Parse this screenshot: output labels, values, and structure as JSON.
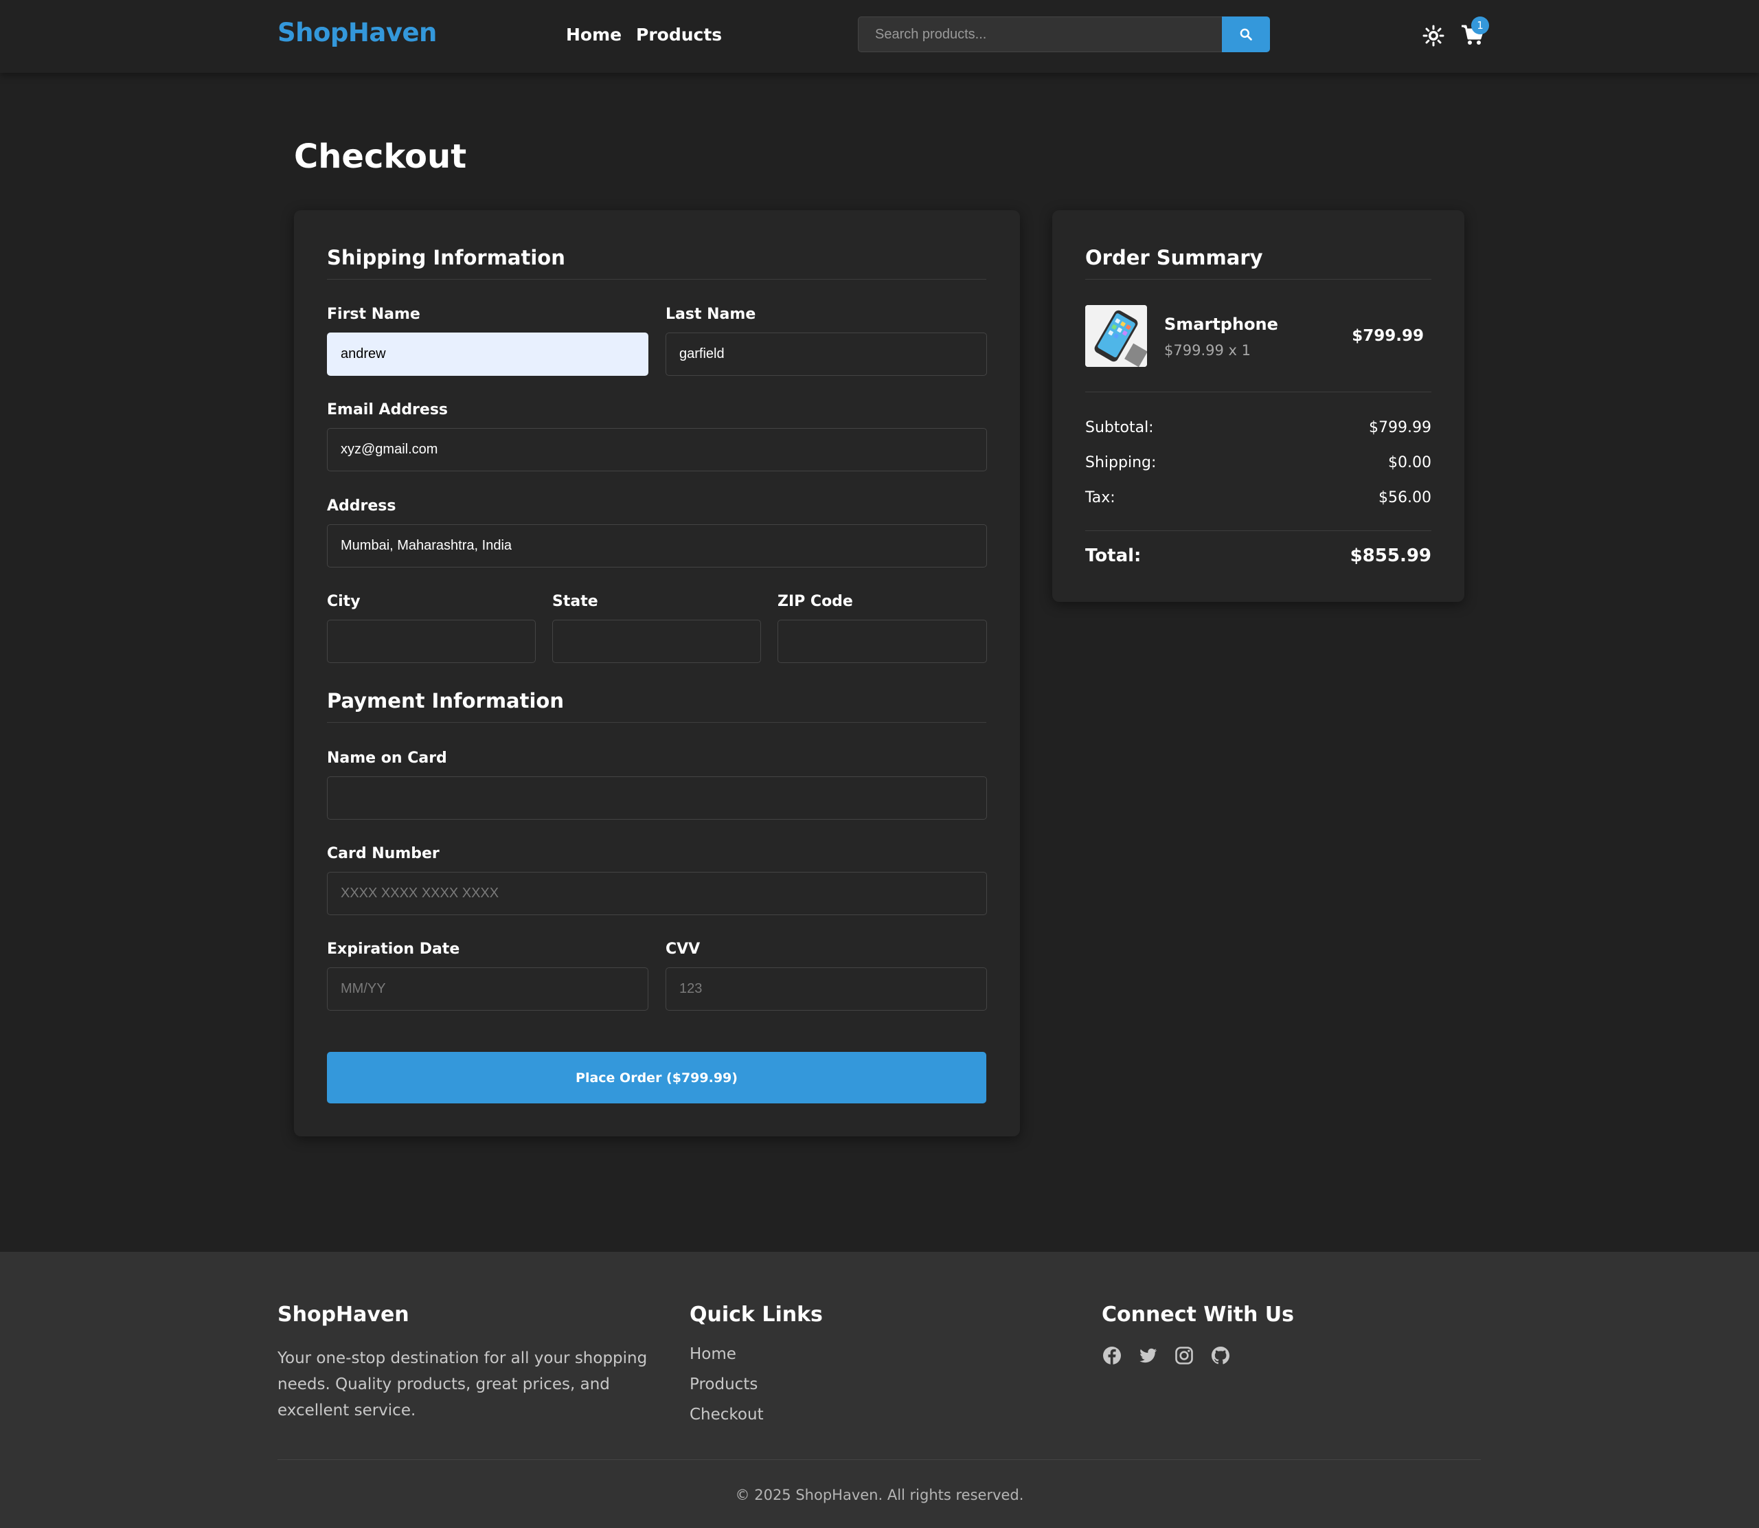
{
  "brand": "ShopHaven",
  "nav": {
    "home": "Home",
    "products": "Products"
  },
  "search": {
    "placeholder": "Search products...",
    "icon": "search-icon"
  },
  "cart": {
    "count": "1"
  },
  "page_title": "Checkout",
  "shipping": {
    "title": "Shipping Information",
    "first_name": {
      "label": "First Name",
      "value": "andrew"
    },
    "last_name": {
      "label": "Last Name",
      "value": "garfield"
    },
    "email": {
      "label": "Email Address",
      "value": "xyz@gmail.com"
    },
    "address": {
      "label": "Address",
      "value": "Mumbai, Maharashtra, India"
    },
    "city": {
      "label": "City",
      "value": ""
    },
    "state": {
      "label": "State",
      "value": ""
    },
    "zip": {
      "label": "ZIP Code",
      "value": ""
    }
  },
  "payment": {
    "title": "Payment Information",
    "name_on_card": {
      "label": "Name on Card",
      "value": ""
    },
    "card_number": {
      "label": "Card Number",
      "placeholder": "XXXX XXXX XXXX XXXX"
    },
    "expiration": {
      "label": "Expiration Date",
      "placeholder": "MM/YY"
    },
    "cvv": {
      "label": "CVV",
      "placeholder": "123"
    }
  },
  "place_order_label": "Place Order ($799.99)",
  "summary": {
    "title": "Order Summary",
    "item": {
      "name": "Smartphone",
      "detail": "$799.99 x 1",
      "price": "$799.99"
    },
    "subtotal_label": "Subtotal:",
    "subtotal": "$799.99",
    "shipping_label": "Shipping:",
    "shipping": "$0.00",
    "tax_label": "Tax:",
    "tax": "$56.00",
    "total_label": "Total:",
    "total": "$855.99"
  },
  "footer": {
    "brand": "ShopHaven",
    "about": "Your one-stop destination for all your shopping needs. Quality products, great prices, and excellent service.",
    "quick_links_title": "Quick Links",
    "links": [
      "Home",
      "Products",
      "Checkout"
    ],
    "connect_title": "Connect With Us",
    "social_icons": [
      "facebook-icon",
      "twitter-icon",
      "instagram-icon",
      "github-icon"
    ],
    "copyright": "© 2025 ShopHaven. All rights reserved."
  },
  "colors": {
    "accent": "#3498db",
    "background": "#212121",
    "card": "#262626",
    "footer": "#333333"
  }
}
